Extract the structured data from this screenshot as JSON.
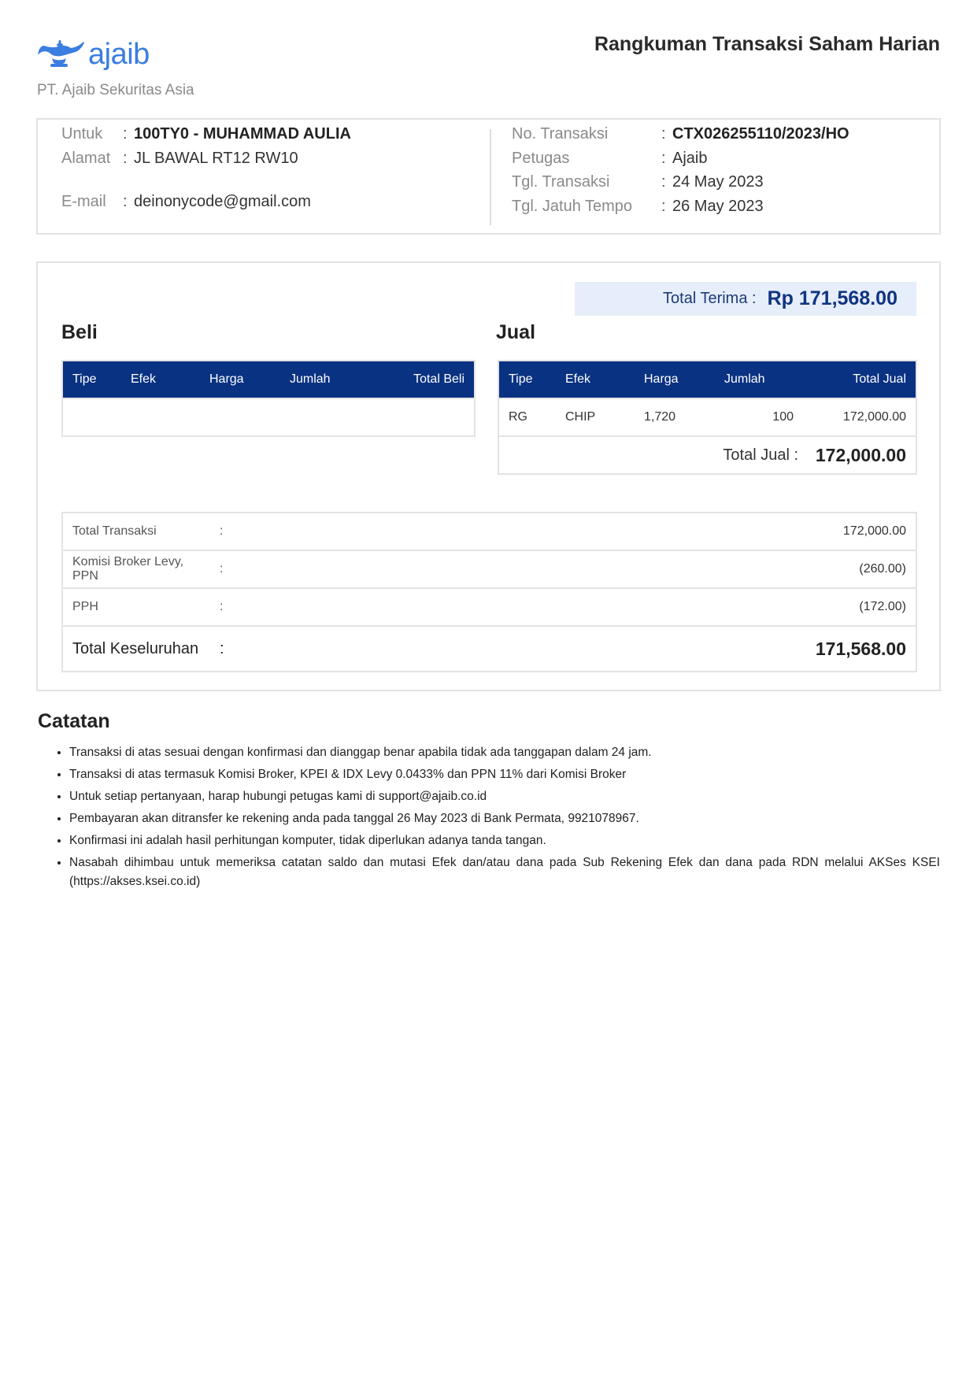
{
  "header": {
    "logo_text": "ajaib",
    "company": "PT. Ajaib Sekuritas Asia",
    "title": "Rangkuman Transaksi Saham Harian"
  },
  "info": {
    "untuk_label": "Untuk",
    "untuk_value": "100TY0 - MUHAMMAD AULIA",
    "alamat_label": "Alamat",
    "alamat_value": "JL BAWAL RT12 RW10",
    "email_label": "E-mail",
    "email_value": "deinonycode@gmail.com",
    "no_transaksi_label": "No. Transaksi",
    "no_transaksi_value": "CTX026255110/2023/HO",
    "petugas_label": "Petugas",
    "petugas_value": "Ajaib",
    "tgl_transaksi_label": "Tgl. Transaksi",
    "tgl_transaksi_value": "24 May 2023",
    "tgl_jatuh_tempo_label": "Tgl. Jatuh Tempo",
    "tgl_jatuh_tempo_value": "26 May 2023",
    "colon": ":"
  },
  "total_terima": {
    "label": "Total Terima :",
    "value": "Rp 171,568.00"
  },
  "beli": {
    "title": "Beli",
    "columns": [
      "Tipe",
      "Efek",
      "Harga",
      "Jumlah",
      "Total Beli"
    ],
    "rows": []
  },
  "jual": {
    "title": "Jual",
    "columns": [
      "Tipe",
      "Efek",
      "Harga",
      "Jumlah",
      "Total Jual"
    ],
    "rows": [
      [
        "RG",
        "CHIP",
        "1,720",
        "100",
        "172,000.00"
      ]
    ],
    "total_label": "Total Jual :",
    "total_value": "172,000.00"
  },
  "summary": {
    "rows": [
      {
        "label": "Total Transaksi",
        "colon": ":",
        "value": "172,000.00"
      },
      {
        "label": "Komisi Broker Levy, PPN",
        "colon": ":",
        "value": "(260.00)"
      },
      {
        "label": "PPH",
        "colon": ":",
        "value": "(172.00)"
      }
    ],
    "grand_label": "Total Keseluruhan",
    "grand_colon": ":",
    "grand_value": "171,568.00"
  },
  "notes": {
    "title": "Catatan",
    "items": [
      "Transaksi di atas sesuai dengan konfirmasi dan dianggap benar apabila tidak ada tanggapan dalam 24 jam.",
      "Transaksi di atas termasuk Komisi Broker, KPEI & IDX Levy 0.0433% dan PPN 11% dari Komisi Broker",
      "Untuk setiap pertanyaan, harap hubungi petugas kami di support@ajaib.co.id",
      "Pembayaran akan ditransfer ke rekening anda pada tanggal 26 May 2023 di Bank Permata, 9921078967.",
      "Konfirmasi ini adalah hasil perhitungan komputer, tidak diperlukan adanya tanda tangan.",
      "Nasabah dihimbau untuk memeriksa catatan saldo dan mutasi Efek dan/atau dana pada Sub Rekening Efek dan dana pada RDN melalui AKSes KSEI (https://akses.ksei.co.id)"
    ]
  },
  "colors": {
    "brand": "#3b7de0",
    "table_header": "#0a3282",
    "total_highlight_bg": "#e6edfb"
  },
  "icons": {
    "logo": "magic-lamp-icon"
  }
}
